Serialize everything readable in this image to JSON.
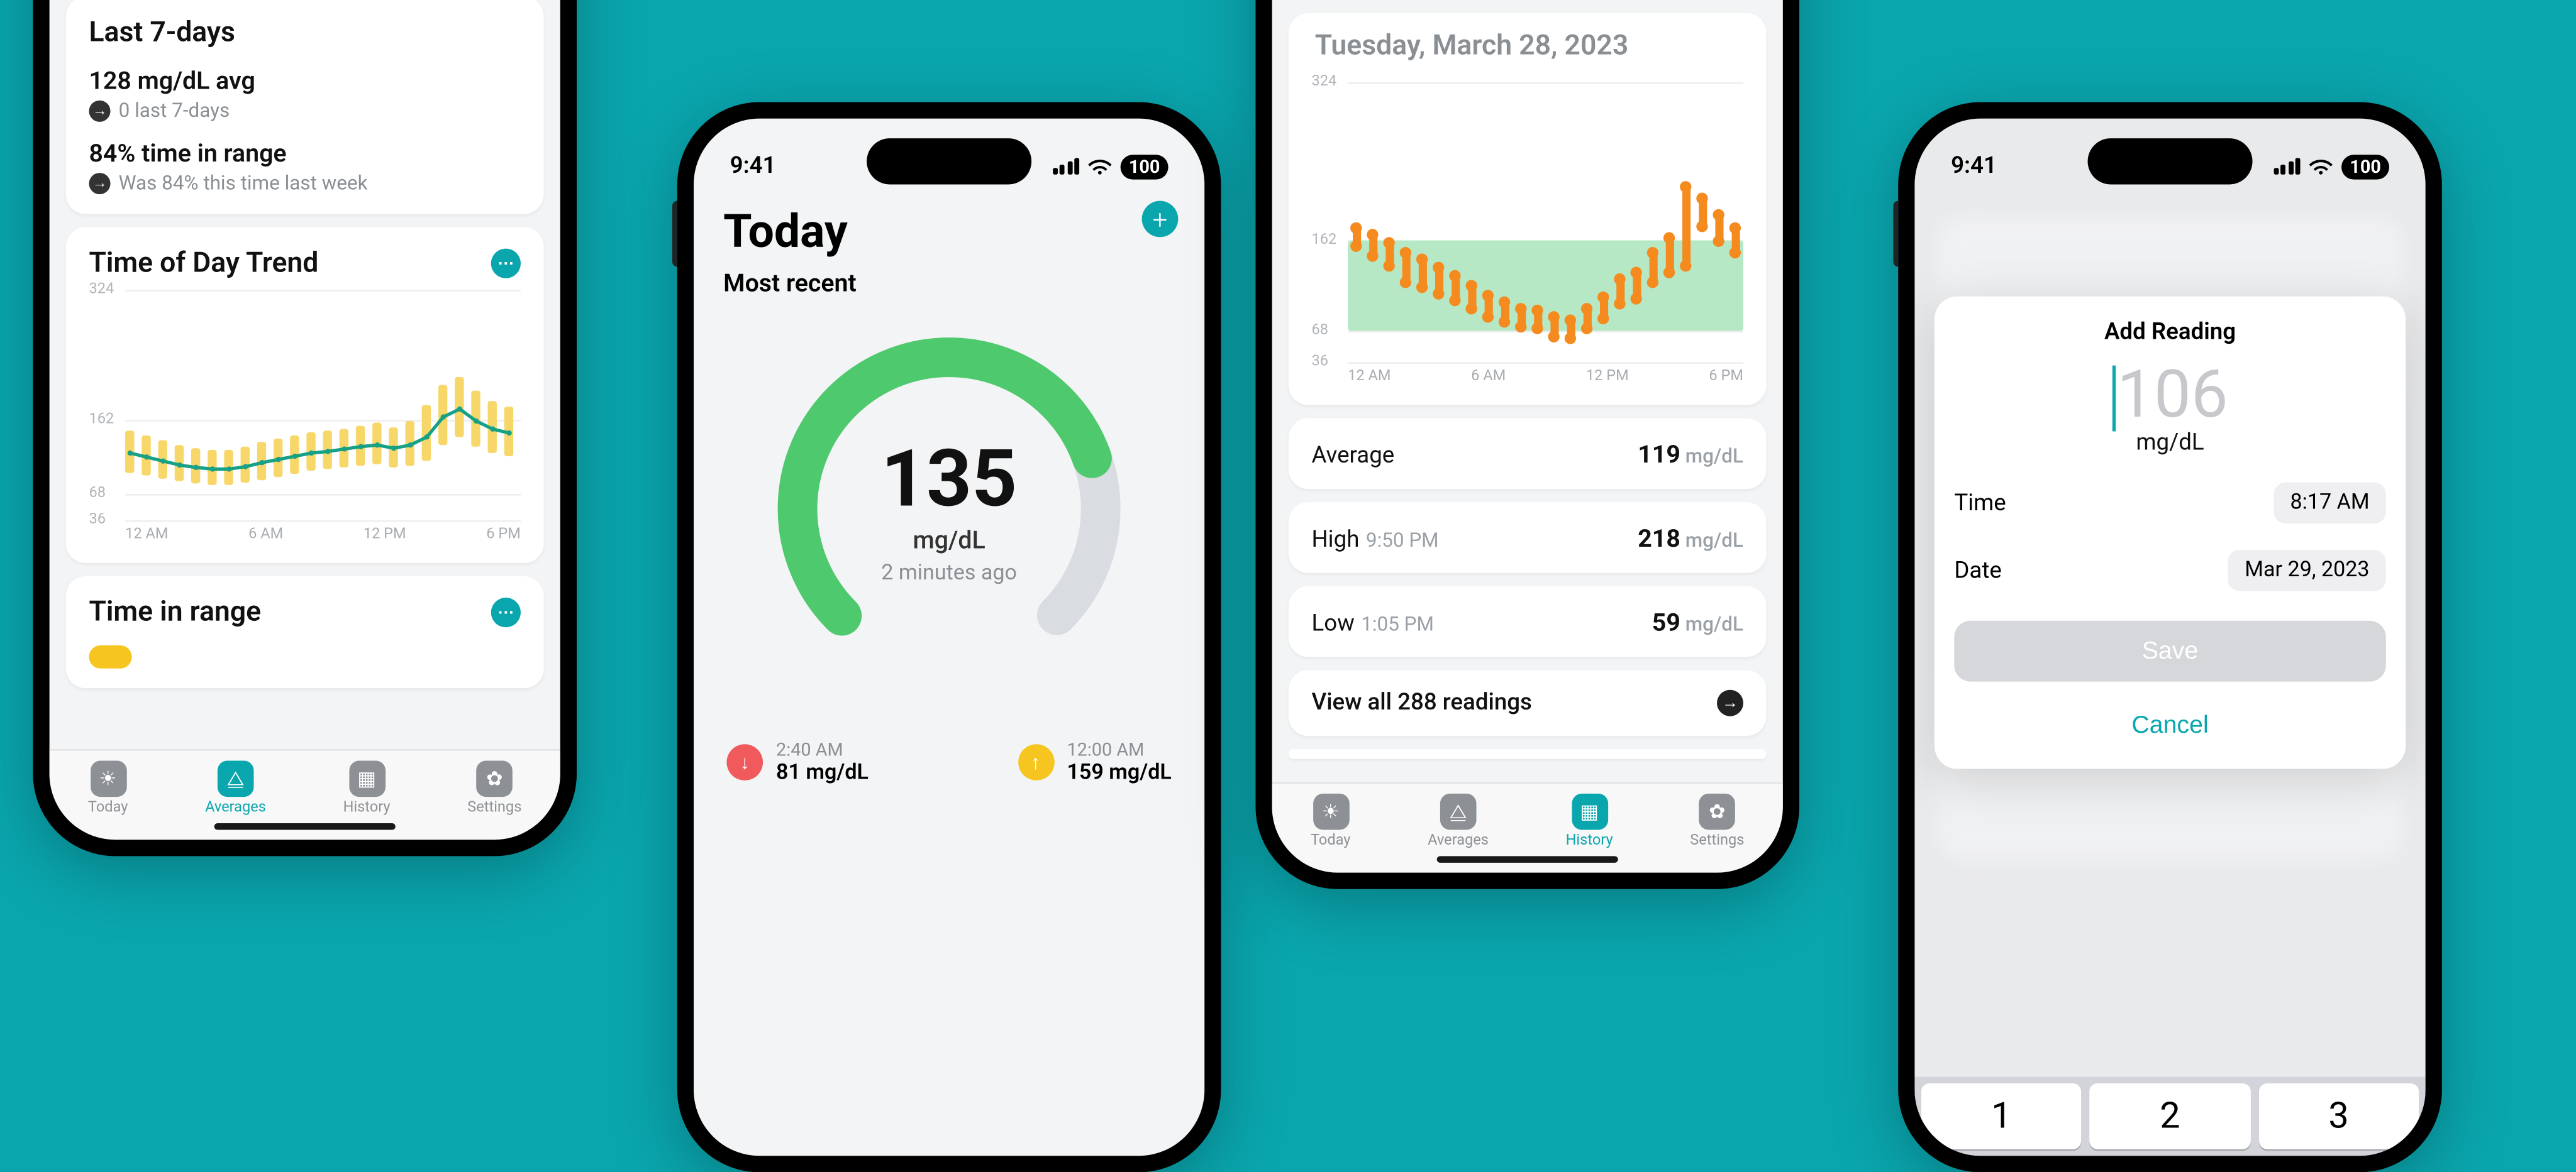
{
  "accent": "#0aa6ae",
  "statusbar": {
    "time": "9:41",
    "battery": "100"
  },
  "tabs": {
    "today": "Today",
    "averages": "Averages",
    "history": "History",
    "settings": "Settings"
  },
  "phone1": {
    "card1": {
      "title": "Last 7-days",
      "avg": "128 mg/dL avg",
      "avg_sub": "0 last 7-days",
      "tir": "84% time in range",
      "tir_sub": "Was 84% this time last week"
    },
    "card2": {
      "title": "Time of Day Trend"
    },
    "card3": {
      "title": "Time in range"
    },
    "active_tab": "averages"
  },
  "chart_data": [
    {
      "type": "line",
      "location": "phone1.card2",
      "title": "Time of Day Trend",
      "x_ticks": [
        "12 AM",
        "6 AM",
        "12 PM",
        "6 PM"
      ],
      "y_ticks": [
        36,
        68,
        162,
        324
      ],
      "ylim": [
        36,
        324
      ],
      "x": [
        0,
        1,
        2,
        3,
        4,
        5,
        6,
        7,
        8,
        9,
        10,
        11,
        12,
        13,
        14,
        15,
        16,
        17,
        18,
        19,
        20,
        21,
        22,
        23
      ],
      "mean": [
        120,
        115,
        110,
        105,
        102,
        100,
        100,
        103,
        108,
        112,
        116,
        120,
        122,
        125,
        128,
        130,
        126,
        130,
        140,
        165,
        175,
        160,
        150,
        145
      ],
      "range_low": [
        95,
        92,
        88,
        85,
        82,
        80,
        80,
        83,
        86,
        90,
        94,
        98,
        100,
        102,
        104,
        106,
        102,
        104,
        110,
        130,
        140,
        128,
        120,
        116
      ],
      "range_high": [
        148,
        142,
        136,
        130,
        126,
        124,
        124,
        128,
        134,
        138,
        142,
        146,
        148,
        150,
        154,
        158,
        152,
        160,
        180,
        205,
        215,
        198,
        185,
        178
      ],
      "colors": {
        "band": "#f8d76a",
        "line": "#16a085"
      }
    },
    {
      "type": "bar",
      "location": "phone3.dayChart",
      "title": "Tuesday, March 28, 2023",
      "x_ticks": [
        "12 AM",
        "6 AM",
        "12 PM",
        "6 PM"
      ],
      "y_ticks": [
        36,
        68,
        162,
        324
      ],
      "ylim": [
        36,
        324
      ],
      "target_range": [
        68,
        162
      ],
      "x": [
        0,
        1,
        2,
        3,
        4,
        5,
        6,
        7,
        8,
        9,
        10,
        11,
        12,
        13,
        14,
        15,
        16,
        17,
        18,
        19,
        20,
        21,
        22,
        23
      ],
      "low": [
        155,
        145,
        135,
        118,
        112,
        105,
        98,
        90,
        82,
        76,
        72,
        70,
        62,
        59,
        70,
        80,
        95,
        100,
        118,
        128,
        135,
        175,
        160,
        148
      ],
      "high": [
        175,
        168,
        160,
        150,
        142,
        134,
        125,
        116,
        106,
        98,
        92,
        90,
        84,
        80,
        92,
        104,
        122,
        130,
        150,
        165,
        218,
        205,
        188,
        175
      ],
      "color": "#f58a1f"
    }
  ],
  "phone2": {
    "title": "Today",
    "subtitle": "Most recent",
    "reading": "135",
    "unit": "mg/dL",
    "ago": "2 minutes ago",
    "low": {
      "time": "2:40 AM",
      "value": "81 mg/dL"
    },
    "high": {
      "time": "12:00 AM",
      "value": "159 mg/dL"
    }
  },
  "phone3": {
    "date": "Tuesday, March 28, 2023",
    "rows": {
      "avg_label": "Average",
      "avg_val": "119",
      "unit": "mg/dL",
      "high_label": "High",
      "high_time": "9:50 PM",
      "high_val": "218",
      "low_label": "Low",
      "low_time": "1:05 PM",
      "low_val": "59",
      "viewall": "View all 288 readings"
    },
    "active_tab": "history"
  },
  "phone4": {
    "title": "Add Reading",
    "value_placeholder": "106",
    "unit": "mg/dL",
    "time_label": "Time",
    "time_value": "8:17 AM",
    "date_label": "Date",
    "date_value": "Mar 29, 2023",
    "save": "Save",
    "cancel": "Cancel",
    "keys": [
      "1",
      "2",
      "3"
    ]
  }
}
